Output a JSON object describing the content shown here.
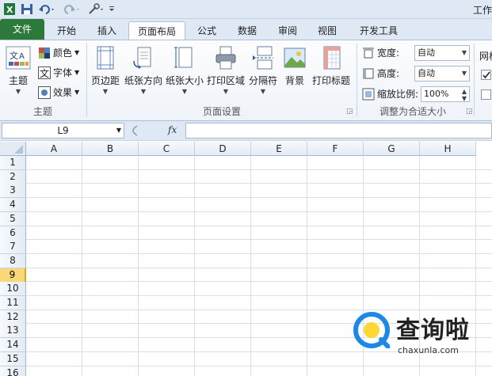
{
  "titlebar": {
    "title": "工作"
  },
  "tabs": [
    {
      "label": "文件"
    },
    {
      "label": "开始"
    },
    {
      "label": "插入"
    },
    {
      "label": "页面布局"
    },
    {
      "label": "公式"
    },
    {
      "label": "数据"
    },
    {
      "label": "审阅"
    },
    {
      "label": "视图"
    },
    {
      "label": "开发工具"
    }
  ],
  "ribbon": {
    "theme_group": {
      "label": "主题",
      "theme_btn": "主题",
      "colors_btn": "颜色",
      "fonts_btn": "字体",
      "effects_btn": "效果"
    },
    "page_setup_group": {
      "label": "页面设置",
      "margins": "页边距",
      "orientation": "纸张方向",
      "size": "纸张大小",
      "print_area": "打印区域",
      "breaks": "分隔符",
      "background": "背景",
      "print_titles": "打印标题"
    },
    "scale_group": {
      "label": "调整为合适大小",
      "width_label": "宽度:",
      "width_value": "自动",
      "height_label": "高度:",
      "height_value": "自动",
      "scale_label": "缩放比例:",
      "scale_value": "100%"
    },
    "sheet_options": {
      "gridlines_label": "网格"
    }
  },
  "formula_bar": {
    "name_box": "L9",
    "fx": "fx",
    "value": ""
  },
  "grid": {
    "columns": [
      "A",
      "B",
      "C",
      "D",
      "E",
      "F",
      "G",
      "H"
    ],
    "rows": [
      "1",
      "2",
      "3",
      "4",
      "5",
      "6",
      "7",
      "8",
      "9",
      "10",
      "11",
      "12",
      "13",
      "14",
      "15",
      "16"
    ],
    "selected_row": "9"
  },
  "watermark": {
    "name": "查询啦",
    "url": "chaxunla.com"
  },
  "colors": {
    "file_tab": "#2b7a3b",
    "selected_row": "#f8d878",
    "watermark_blue": "#1e88e5"
  }
}
